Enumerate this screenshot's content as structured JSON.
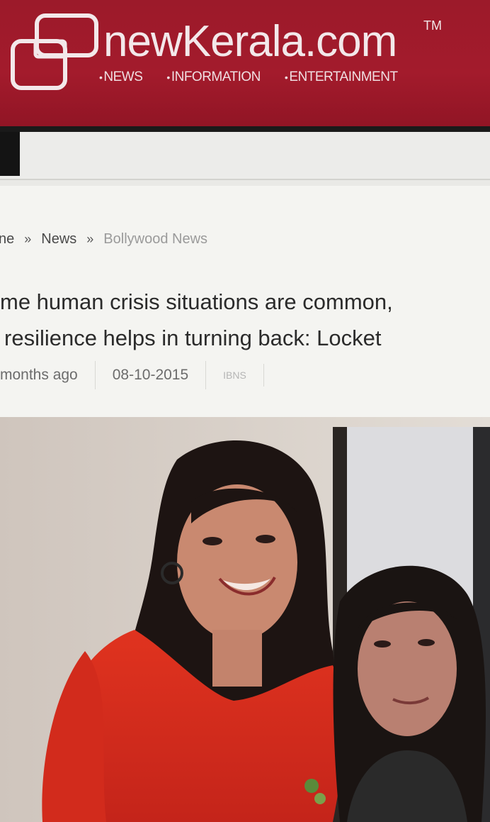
{
  "site": {
    "brand": "newKerala.com",
    "trademark": "TM",
    "tagline": [
      "NEWS",
      "INFORMATION",
      "ENTERTAINMENT"
    ]
  },
  "breadcrumb": [
    "ne",
    "News",
    "Bollywood News"
  ],
  "article": {
    "headline_lines": [
      "me human crisis situations are common,",
      "resilience helps in turning back: Locket"
    ],
    "posted_ago": "months ago",
    "date": "08-10-2015",
    "source": "IBNS"
  },
  "colors": {
    "header": "#a31b2c",
    "menu_button": "#141414"
  },
  "photo": {
    "type": "news-photo",
    "subjects": "woman in red dress and young girl"
  }
}
